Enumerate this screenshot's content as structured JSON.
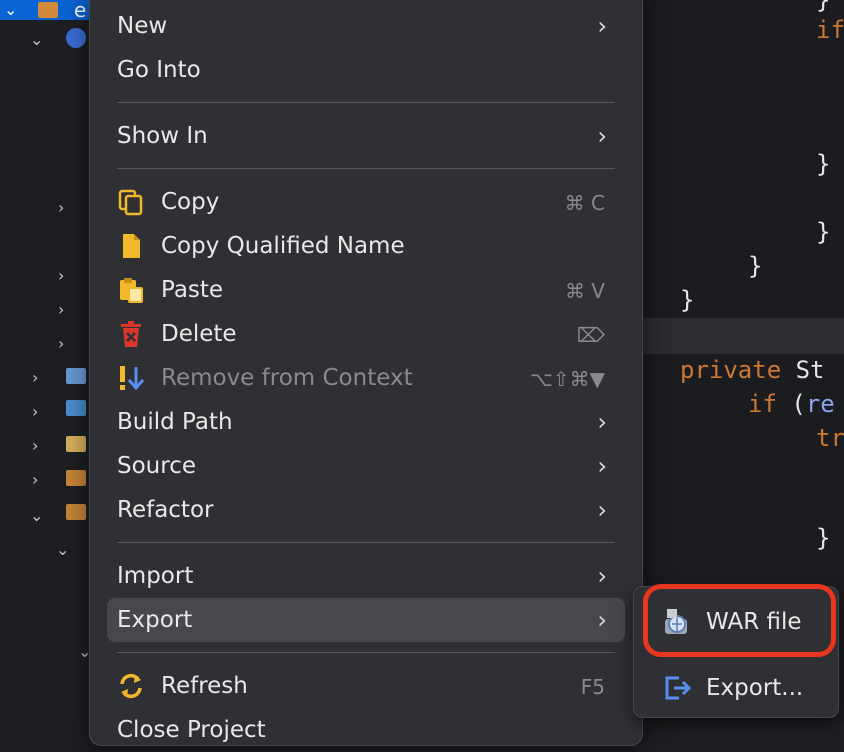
{
  "context_menu": {
    "new": "New",
    "go_into": "Go Into",
    "show_in": "Show In",
    "copy": "Copy",
    "copy_shortcut": "⌘ C",
    "copy_qualified_name": "Copy Qualified Name",
    "paste": "Paste",
    "paste_shortcut": "⌘ V",
    "delete": "Delete",
    "delete_shortcut": "⌦",
    "remove_from_context": "Remove from Context",
    "remove_shortcut": "⌥⇧⌘▼",
    "build_path": "Build Path",
    "source": "Source",
    "refactor": "Refactor",
    "import": "Import",
    "export": "Export",
    "refresh": "Refresh",
    "refresh_shortcut": "F5",
    "close_project_partial": "Close Project"
  },
  "export_submenu": {
    "war_file": "WAR file",
    "export_more": "Export..."
  },
  "editor": {
    "line_if_top": "if",
    "brace1": "}",
    "brace2": "}",
    "brace3": "}",
    "brace4": "}",
    "brace5": "}",
    "kw_private": "private",
    "type_partial": "St",
    "kw_if": "if",
    "paren": " (",
    "ident_partial": "re",
    "kw_try_partial": "tr",
    "brace6": "}"
  },
  "tree": {
    "selected_label_partial": "e"
  },
  "colors": {
    "menu_bg": "#2f3034",
    "highlight": "#47484c",
    "callout": "#e8361e",
    "keyword": "#cc7832",
    "selection": "#0a64d6"
  },
  "icons": [
    "copy-icon",
    "copy-qualified-name-icon",
    "paste-icon",
    "delete-icon",
    "remove-from-context-icon",
    "refresh-icon",
    "war-file-icon",
    "export-icon",
    "chevron-right-icon",
    "chevron-down-icon"
  ]
}
